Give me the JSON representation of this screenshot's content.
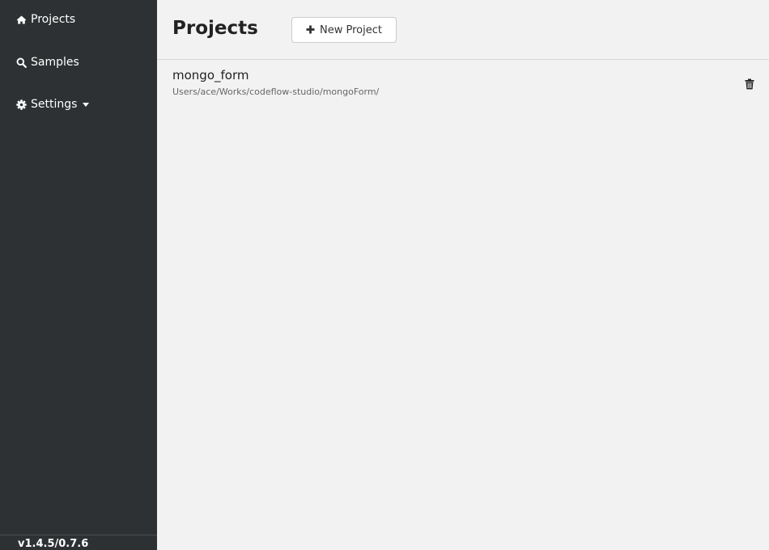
{
  "sidebar": {
    "items": [
      {
        "label": "Projects",
        "icon": "home-icon"
      },
      {
        "label": "Samples",
        "icon": "search-icon"
      },
      {
        "label": "Settings",
        "icon": "gear-icon"
      }
    ],
    "version": "v1.4.5/0.7.6"
  },
  "header": {
    "title": "Projects",
    "new_project_label": "New Project"
  },
  "projects": [
    {
      "name": "mongo_form",
      "path": "Users/ace/Works/codeflow-studio/mongoForm/"
    }
  ],
  "colors": {
    "sidebar_bg": "#2e3133",
    "main_bg": "#f2f2f2",
    "text_dark": "#222222"
  }
}
